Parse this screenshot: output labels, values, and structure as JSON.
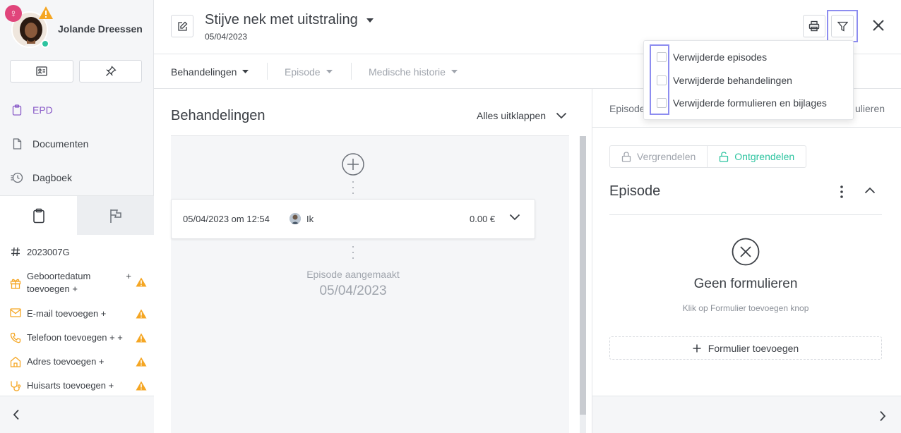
{
  "patient": {
    "name": "Jolande Dreessen",
    "gender_symbol": "♀"
  },
  "sidebar": {
    "nav": [
      {
        "label": "EPD",
        "icon": "clipboard-icon",
        "active": true
      },
      {
        "label": "Documenten",
        "icon": "document-icon",
        "active": false
      },
      {
        "label": "Dagboek",
        "icon": "history-icon",
        "active": false
      }
    ],
    "info": [
      {
        "label": "2023007G",
        "icon": "hash-icon",
        "warn": false
      },
      {
        "label": "Geboortedatum + toevoegen +",
        "label_line1": "Geboortedatum",
        "label_line2": "toevoegen +",
        "plus": "+",
        "icon": "gift-icon",
        "warn": true
      },
      {
        "label": "E-mail toevoegen +",
        "icon": "mail-icon",
        "warn": true
      },
      {
        "label": "Telefoon toevoegen + +",
        "icon": "phone-icon",
        "warn": true
      },
      {
        "label": "Adres toevoegen +",
        "icon": "home-icon",
        "warn": true
      },
      {
        "label": "Huisarts toevoegen +",
        "icon": "stethoscope-icon",
        "warn": true
      }
    ]
  },
  "header": {
    "title": "Stijve nek met uitstraling",
    "date": "05/04/2023"
  },
  "subnav": {
    "items": [
      {
        "label": "Behandelingen",
        "active": true
      },
      {
        "label": "Episode",
        "active": false
      },
      {
        "label": "Medische historie",
        "active": false
      }
    ]
  },
  "main": {
    "title": "Behandelingen",
    "expand_all": "Alles uitklappen",
    "treatment": {
      "datetime": "05/04/2023 om 12:54",
      "user": "Ik",
      "amount": "0.00 €"
    },
    "episode_created_label": "Episode aangemaakt",
    "episode_created_date": "05/04/2023"
  },
  "right": {
    "tabs": [
      {
        "label": "Episode"
      },
      {
        "label": "ulieren"
      }
    ],
    "lock_label": "Vergrendelen",
    "unlock_label": "Ontgrendelen",
    "episode_title": "Episode",
    "empty_title": "Geen formulieren",
    "empty_sub": "Klik op Formulier toevoegen knop",
    "add_form": "Formulier toevoegen"
  },
  "filter_dropdown": {
    "options": [
      {
        "label": "Verwijderde episodes",
        "checked": false
      },
      {
        "label": "Verwijderde behandelingen",
        "checked": false
      },
      {
        "label": "Verwijderde formulieren en bijlages",
        "checked": false
      }
    ]
  },
  "colors": {
    "accent_purple": "#8a5cc8",
    "highlight": "#8d8df0",
    "warning": "#f5a623",
    "success": "#2ec4a0",
    "gender": "#e0457b"
  }
}
